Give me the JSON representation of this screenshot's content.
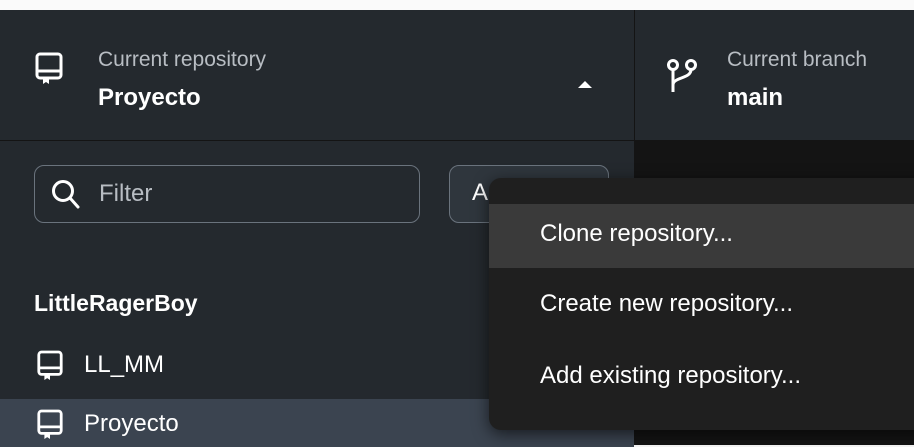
{
  "repository": {
    "caption": "Current repository",
    "name": "Proyecto"
  },
  "branch": {
    "caption": "Current branch",
    "name": "main"
  },
  "filter": {
    "placeholder": "Filter",
    "value": ""
  },
  "add_button": {
    "label": "A"
  },
  "repo_list": {
    "group": "LittleRagerBoy",
    "items": [
      {
        "label": "LL_MM",
        "selected": false
      },
      {
        "label": "Proyecto",
        "selected": true
      }
    ]
  },
  "add_menu": {
    "items": [
      {
        "label": "Clone repository...",
        "highlighted": true
      },
      {
        "label": "Create new repository...",
        "highlighted": false
      },
      {
        "label": "Add existing repository...",
        "highlighted": false
      }
    ]
  },
  "icons": [
    "repo-icon",
    "caret-up-icon",
    "git-branch-icon",
    "search-icon"
  ],
  "colors": {
    "sidebar_bg": "#24292e",
    "selected_row": "#3b4450",
    "menu_bg": "#1f1f1f",
    "menu_highlight": "#3a3a3a",
    "main_bg": "#141414"
  }
}
